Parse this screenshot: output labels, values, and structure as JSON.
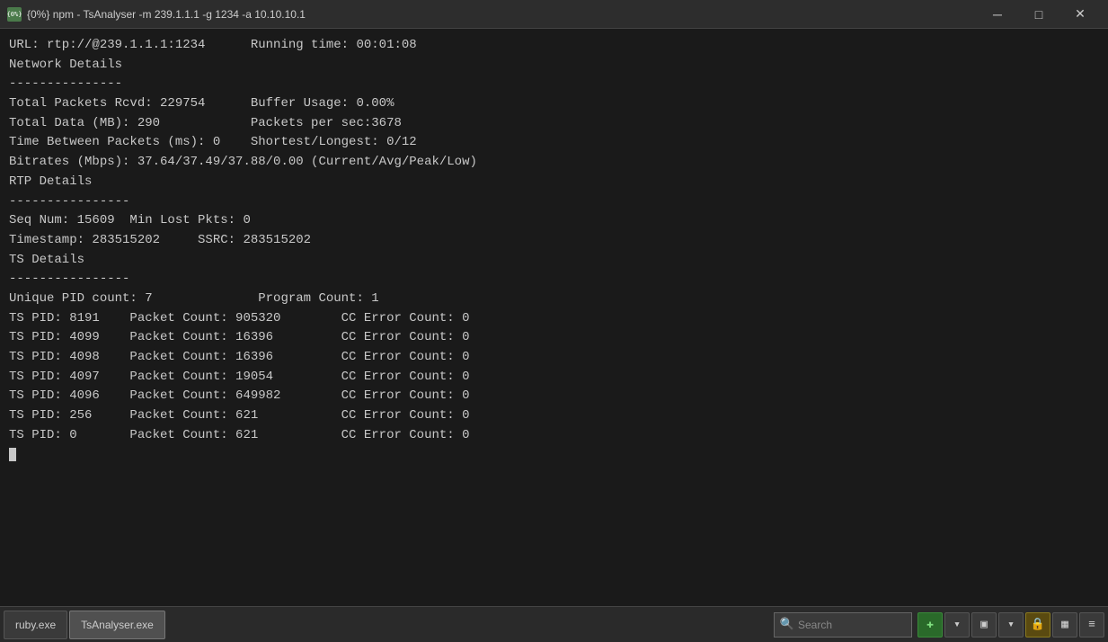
{
  "titlebar": {
    "icon_label": "{0%}",
    "title": "{0%} npm - TsAnalyser  -m 239.1.1.1 -g 1234 -a 10.10.10.1",
    "minimize_label": "─",
    "maximize_label": "□",
    "close_label": "✕"
  },
  "terminal": {
    "lines": [
      "URL: rtp://@239.1.1.1:1234      Running time: 00:01:08",
      "",
      "Network Details",
      "---------------",
      "Total Packets Rcvd: 229754      Buffer Usage: 0.00%",
      "Total Data (MB): 290            Packets per sec:3678",
      "Time Between Packets (ms): 0    Shortest/Longest: 0/12",
      "Bitrates (Mbps): 37.64/37.49/37.88/0.00 (Current/Avg/Peak/Low)",
      "",
      "RTP Details",
      "----------------",
      "Seq Num: 15609  Min Lost Pkts: 0",
      "Timestamp: 283515202     SSRC: 283515202",
      "",
      "TS Details",
      "----------------",
      "Unique PID count: 7              Program Count: 1",
      "TS PID: 8191    Packet Count: 905320        CC Error Count: 0",
      "TS PID: 4099    Packet Count: 16396         CC Error Count: 0",
      "TS PID: 4098    Packet Count: 16396         CC Error Count: 0",
      "TS PID: 4097    Packet Count: 19054         CC Error Count: 0",
      "TS PID: 4096    Packet Count: 649982        CC Error Count: 0",
      "TS PID: 256     Packet Count: 621           CC Error Count: 0",
      "TS PID: 0       Packet Count: 621           CC Error Count: 0"
    ],
    "cursor_visible": true
  },
  "taskbar": {
    "tabs": [
      {
        "label": "ruby.exe",
        "active": false
      },
      {
        "label": "TsAnalyser.exe",
        "active": true
      }
    ],
    "search_placeholder": "Search",
    "icons": [
      {
        "name": "plus-icon",
        "symbol": "✚",
        "style": "green"
      },
      {
        "name": "chevron-down-icon",
        "symbol": "▾",
        "style": "normal"
      },
      {
        "name": "window-icon",
        "symbol": "▣",
        "style": "normal"
      },
      {
        "name": "chevron-down-2-icon",
        "symbol": "▾",
        "style": "normal"
      },
      {
        "name": "lock-icon",
        "symbol": "🔒",
        "style": "gold"
      },
      {
        "name": "layout-icon",
        "symbol": "▦",
        "style": "normal"
      },
      {
        "name": "menu-icon",
        "symbol": "≡",
        "style": "normal"
      }
    ]
  }
}
